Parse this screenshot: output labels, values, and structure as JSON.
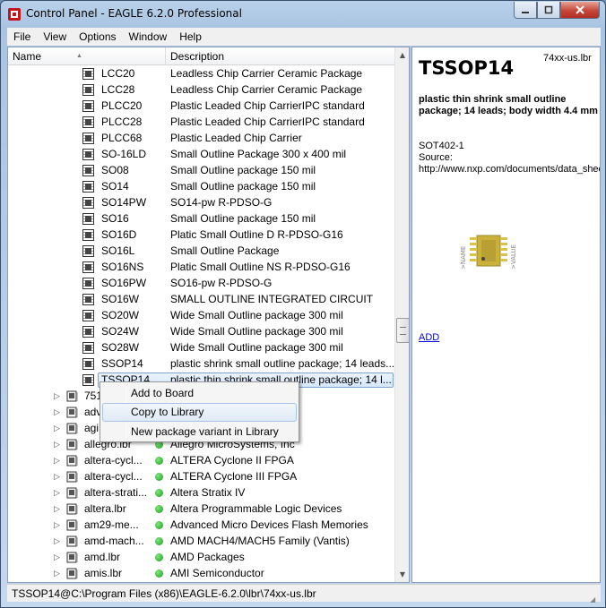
{
  "window": {
    "title": "Control Panel - EAGLE 6.2.0 Professional"
  },
  "menu": [
    "File",
    "View",
    "Options",
    "Window",
    "Help"
  ],
  "columns": {
    "name": "Name",
    "description": "Description"
  },
  "packages": [
    {
      "name": "LCC20",
      "desc": "Leadless Chip Carrier Ceramic Package"
    },
    {
      "name": "LCC28",
      "desc": "Leadless Chip Carrier Ceramic Package"
    },
    {
      "name": "PLCC20",
      "desc": "Plastic Leaded Chip CarrierIPC standard"
    },
    {
      "name": "PLCC28",
      "desc": "Plastic Leaded Chip CarrierIPC standard"
    },
    {
      "name": "PLCC68",
      "desc": "Plastic Leaded Chip Carrier"
    },
    {
      "name": "SO-16LD",
      "desc": "Small Outline Package 300 x 400 mil"
    },
    {
      "name": "SO08",
      "desc": "Small Outline package 150 mil"
    },
    {
      "name": "SO14",
      "desc": "Small Outline package 150 mil"
    },
    {
      "name": "SO14PW",
      "desc": "SO14-pw R-PDSO-G"
    },
    {
      "name": "SO16",
      "desc": "Small Outline package 150 mil"
    },
    {
      "name": "SO16D",
      "desc": "Platic Small Outline D R-PDSO-G16"
    },
    {
      "name": "SO16L",
      "desc": "Small Outline Package"
    },
    {
      "name": "SO16NS",
      "desc": "Platic Small Outline NS R-PDSO-G16"
    },
    {
      "name": "SO16PW",
      "desc": "SO16-pw R-PDSO-G"
    },
    {
      "name": "SO16W",
      "desc": "SMALL OUTLINE INTEGRATED CIRCUIT"
    },
    {
      "name": "SO20W",
      "desc": "Wide Small Outline package 300 mil"
    },
    {
      "name": "SO24W",
      "desc": "Wide Small Outline package 300 mil"
    },
    {
      "name": "SO28W",
      "desc": "Wide Small Outline package 300 mil"
    },
    {
      "name": "SSOP14",
      "desc": "plastic shrink small outline package; 14 leads..."
    },
    {
      "name": "TSSOP14",
      "desc": "plastic thin shrink small outline package; 14 l..."
    }
  ],
  "libraries": [
    {
      "name": "751",
      "desc": ""
    },
    {
      "name": "adv",
      "desc": "s - Phoenix, Arizo..."
    },
    {
      "name": "agi",
      "desc": ""
    },
    {
      "name": "allegro.lbr",
      "desc": "Allegro MicroSystems, Inc"
    },
    {
      "name": "altera-cycl...",
      "desc": "ALTERA Cyclone II FPGA"
    },
    {
      "name": "altera-cycl...",
      "desc": "ALTERA Cyclone III FPGA"
    },
    {
      "name": "altera-strati...",
      "desc": "Altera Stratix IV"
    },
    {
      "name": "altera.lbr",
      "desc": "Altera Programmable Logic Devices"
    },
    {
      "name": "am29-me...",
      "desc": "Advanced Micro Devices Flash Memories"
    },
    {
      "name": "amd-mach...",
      "desc": "AMD MACH4/MACH5 Family (Vantis)"
    },
    {
      "name": "amd.lbr",
      "desc": "AMD Packages"
    },
    {
      "name": "amis.lbr",
      "desc": "AMI Semiconductor"
    }
  ],
  "context_menu": [
    "Add to Board",
    "Copy to Library",
    "New package variant in Library"
  ],
  "preview": {
    "title": "TSSOP14",
    "library": "74xx-us.lbr",
    "description": "plastic thin shrink small outline package; 14 leads; body width 4.4 mm",
    "info_line1": "SOT402-1",
    "info_line2": "Source:",
    "info_line3": "http://www.nxp.com/documents/data_sheet",
    "symbol_name": ">NAME",
    "symbol_value": ">VALUE",
    "add_link": "ADD"
  },
  "status": "TSSOP14@C:\\Program Files (x86)\\EAGLE-6.2.0\\lbr\\74xx-us.lbr"
}
